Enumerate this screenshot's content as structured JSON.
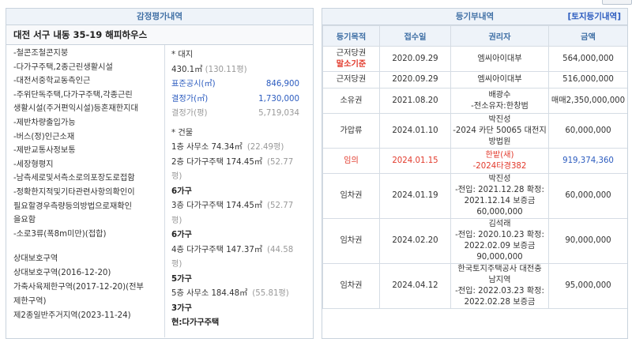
{
  "left": {
    "header": "감정평가내역",
    "address": "대전 서구 내동 35-19 해피하우스",
    "features": [
      "-철콘조철콘지붕",
      "-다가구주택,2종근린생활시설",
      "-대전서중학교동측인근",
      "-주위단독주택,다가구주택,각종근린",
      "생활시설(주거편익시설)등혼재한지대",
      "-제반차량출입가능",
      "-버스(정)인근소재",
      "-제반교통사정보통",
      "-세장형평지",
      "-남측세로및서측소로의포장도로접함",
      "-정확한지적및기타관련사항의확인이",
      "필요할경우측량등의방법으로재확인",
      "을요함",
      "-소로3류(폭8m미만)(접합)"
    ],
    "zones": [
      "상대보호구역",
      "상대보호구역(2016-12-20)",
      "가축사육제한구역(2017-12-20)(전부",
      "제한구역)",
      "제2종일반주거지역(2023-11-24)"
    ],
    "land": {
      "title": "* 대지",
      "area": "430.1㎡",
      "area_pyeong": "(130.11평)",
      "official_label": "표준공시(㎡)",
      "official_value": "846,900",
      "decided_label": "결정가(㎡)",
      "decided_value": "1,730,000",
      "decided_pyeong_label": "결정가(평)",
      "decided_pyeong_value": "5,719,034"
    },
    "building": {
      "title": "* 건물",
      "floors": [
        {
          "text": "1층 사무소 74.34㎡",
          "pyeong": "(22.49평)",
          "extra": ""
        },
        {
          "text": "2층 다가구주택 174.45㎡",
          "pyeong": "(52.77",
          "extra": "평)"
        },
        {
          "text": "",
          "pyeong": "",
          "extra": "6가구",
          "bold": true
        },
        {
          "text": "3층 다가구주택 174.45㎡",
          "pyeong": "(52.77",
          "extra": "평)"
        },
        {
          "text": "",
          "pyeong": "",
          "extra": "6가구",
          "bold": true
        },
        {
          "text": "4층 다가구주택 147.37㎡",
          "pyeong": "(44.58",
          "extra": "평)"
        },
        {
          "text": "",
          "pyeong": "",
          "extra": "5가구",
          "bold": true
        },
        {
          "text": "5층 사무소 184.48㎡",
          "pyeong": "(55.81평)",
          "extra": ""
        },
        {
          "text": "",
          "pyeong": "",
          "extra": "3가구",
          "bold": true
        },
        {
          "text": "",
          "pyeong": "",
          "extra": "현:다가구주택",
          "bold": true
        }
      ]
    }
  },
  "right": {
    "header": "등기부내역",
    "header_link": "[토지등기내역]",
    "columns": [
      "등기목적",
      "접수일",
      "권리자",
      "금액"
    ],
    "rows": [
      {
        "purpose": "근저당권",
        "purpose2": "말소기준",
        "date": "2020.09.29",
        "holder": [
          "엠씨아이대부"
        ],
        "amount": "564,000,000",
        "style": "md"
      },
      {
        "purpose": "근저당권",
        "purpose2": "",
        "date": "2020.09.29",
        "holder": [
          "엠씨아이대부"
        ],
        "amount": "516,000,000",
        "style": "sm"
      },
      {
        "purpose": "소유권",
        "purpose2": "",
        "date": "2021.08.20",
        "holder": [
          "배광수",
          "-전소유자:한창범"
        ],
        "amount": "매매2,350,000,000",
        "style": "md"
      },
      {
        "purpose": "가압류",
        "purpose2": "",
        "date": "2024.01.10",
        "holder": [
          "박진성",
          "-2024 카단 50065 대전지",
          "방법원"
        ],
        "amount": "60,000,000",
        "style": "lg"
      },
      {
        "purpose": "임의",
        "purpose2": "",
        "date": "2024.01.15",
        "holder": [
          "한밭(새)",
          "-2024타경382"
        ],
        "amount": "919,374,360",
        "style": "md",
        "highlight": true
      },
      {
        "purpose": "임차권",
        "purpose2": "",
        "date": "2024.01.19",
        "holder": [
          "박진성",
          "-전입: 2021.12.28 확정:",
          "2021.12.14 보증금",
          "60,000,000"
        ],
        "amount": "60,000,000",
        "style": "xl"
      },
      {
        "purpose": "임차권",
        "purpose2": "",
        "date": "2024.02.20",
        "holder": [
          "김석래",
          "-전입: 2020.10.23 확정:",
          "2022.02.09 보증금",
          "90,000,000"
        ],
        "amount": "90,000,000",
        "style": "xl"
      },
      {
        "purpose": "임차권",
        "purpose2": "",
        "date": "2024.04.12",
        "holder": [
          "한국토지주택공사 대전충",
          "남지역",
          "-전입: 2022.03.23 확정:",
          "2022.02.28 보증금"
        ],
        "amount": "95,000,000",
        "style": "xl"
      }
    ]
  }
}
